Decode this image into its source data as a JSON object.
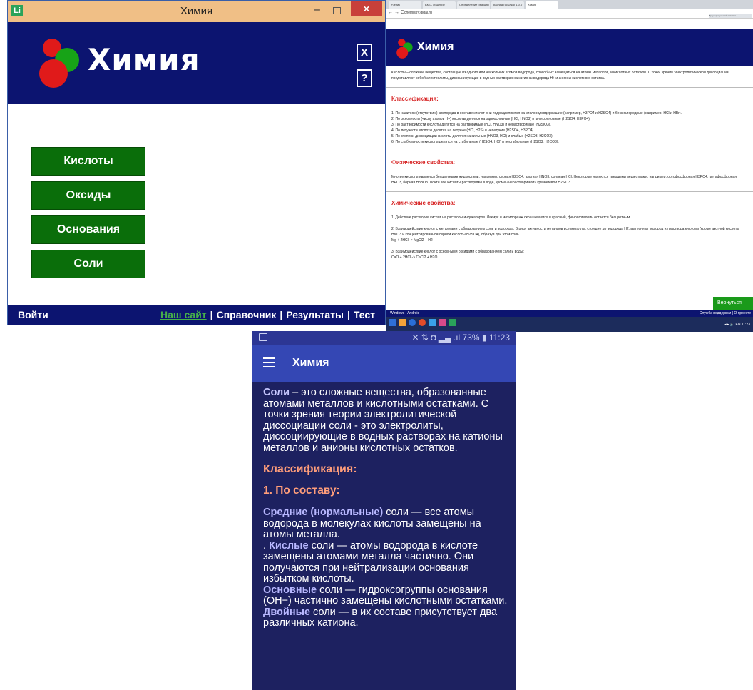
{
  "desktop": {
    "window_title": "Химия",
    "app_icon": "Li",
    "close_symbol": "×",
    "brand": "Химия",
    "btn_x": "X",
    "btn_help": "?",
    "menu": [
      "Кислоты",
      "Оксиды",
      "Основания",
      "Соли"
    ],
    "login": "Войти",
    "footer_links": [
      "Наш сайт",
      "Справочник",
      "Результаты",
      "Тест"
    ],
    "separator": "|"
  },
  "browser": {
    "tabs": [
      "Ученик",
      "БКБ - общение",
      "Определение реакции",
      "распад (ссылка) 1.0.0",
      "Химия"
    ],
    "nav": "← → C",
    "url": "chemistry.digal.ru",
    "ext_label": "Браузер с учётной записью",
    "brand": "Химия",
    "intro": "Кислоты – сложные вещества, состоящие из одного или нескольких атомов водорода, способных замещаться на атомы металлов, и кислотных остатков. С точки зрения электролитической диссоциации представляют собой электролиты, диссоциирующие в водных растворах на катионы водорода H+ и анионы кислотного остатка.",
    "h_class": "Классификация:",
    "class_items": [
      "1. По наличию (отсутствию) кислорода в составе кислот они подразделяются на кислородсодержащие (например, H3PO4 и H2SO4) и бескислородные (например, HCl и HBr).",
      "2. По основности (числу атомов H+) кислоты делятся на одноосновные (HCl, HNO3) и многоосновные (H2SO4, H3PO4).",
      "3. По растворимости кислоты делятся на растворимые (HCl, HNO3) и нерастворимые (H2SiO3).",
      "4. По летучести кислоты делятся на летучие (HCl, H2S) и нелетучие (H2SO4, H3PO4).",
      "5. По степени диссоциации кислоты делятся на сильные (HNO3, HCl) и слабые (H2SO3, H2CO3).",
      "6. По стабильности кислоты делятся на стабильные (H2SO4, HCl) и нестабильные (H2SO3, H2CO3)."
    ],
    "h_phys": "Физические свойства:",
    "phys_text": "Многие кислоты являются бесцветными жидкостями, например, серная H2SO4, азотная HNO3, соляная HCl. Некоторые являются твердыми веществами, например, ортофосфорная H3PO4, метафосфорная HPO3, борная H3BO3. Почти все кислоты растворимы в воде, кроме «нерастворимой» кремниевой H2SiO3.",
    "h_chem": "Химические свойства:",
    "chem_1": "1. Действие растворов кислот на растворы индикаторов. Лакмус и метилоранж окрашиваются в красный, фенолфталеин остается бесцветным.",
    "chem_2": "2. Взаимодействие кислот с металлами с образованием соли и водорода. В ряду активности металлов все металлы, стоящие до водорода H2, вытесняют водород из раствора кислоты (кроме азотной кислоты HNO3 и концентрированной серной кислоты H2SO4), образуя при этом соль.",
    "chem_eq1": "Mg + 2HCl -> MgCl2 + H2",
    "chem_3": "3. Взаимодействие кислот с основными оксидами с образованием соли и воды:",
    "chem_eq2": "CaO + 2HCl -> CaCl2 + H2O",
    "back": "Вернуться",
    "footer_left": "Windows | Android",
    "footer_right": "Служба поддержки | О проекте",
    "tray": "◂ ▸ 🔈 EN 11:23"
  },
  "phone": {
    "status_right": "✕  ⇅ ◘ ▂▄ .ıl 73% ▮ 11:23",
    "title": "Химия",
    "intro_b": "Соли",
    "intro": " – это сложные вещества, образованные атомами металлов и кислотными остатками. С точки зрения теории электролитической диссоциации соли - это электролиты, диссоциирующие в водных растворах на катионы металлов и анионы кислотных остатков.",
    "h1": "Классификация:",
    "h2": "1. По составу:",
    "p1_b": "Средние (нормальные)",
    "p1": " соли — все атомы водорода в молекулах кислоты замещены на атомы металла.",
    "p2_pre": ". ",
    "p2_b": "Кислые",
    "p2": " соли — атомы водорода в кислоте замещены атомами металла частично. Они получаются при нейтрализации основания избытком кислоты.",
    "p3_b": "Основные",
    "p3": " соли — гидроксогруппы основания (OH−) частично замещены кислотными остатками.",
    "p4_b": "Двойные",
    "p4": " соли — в их составе присутствует два различных катиона."
  }
}
